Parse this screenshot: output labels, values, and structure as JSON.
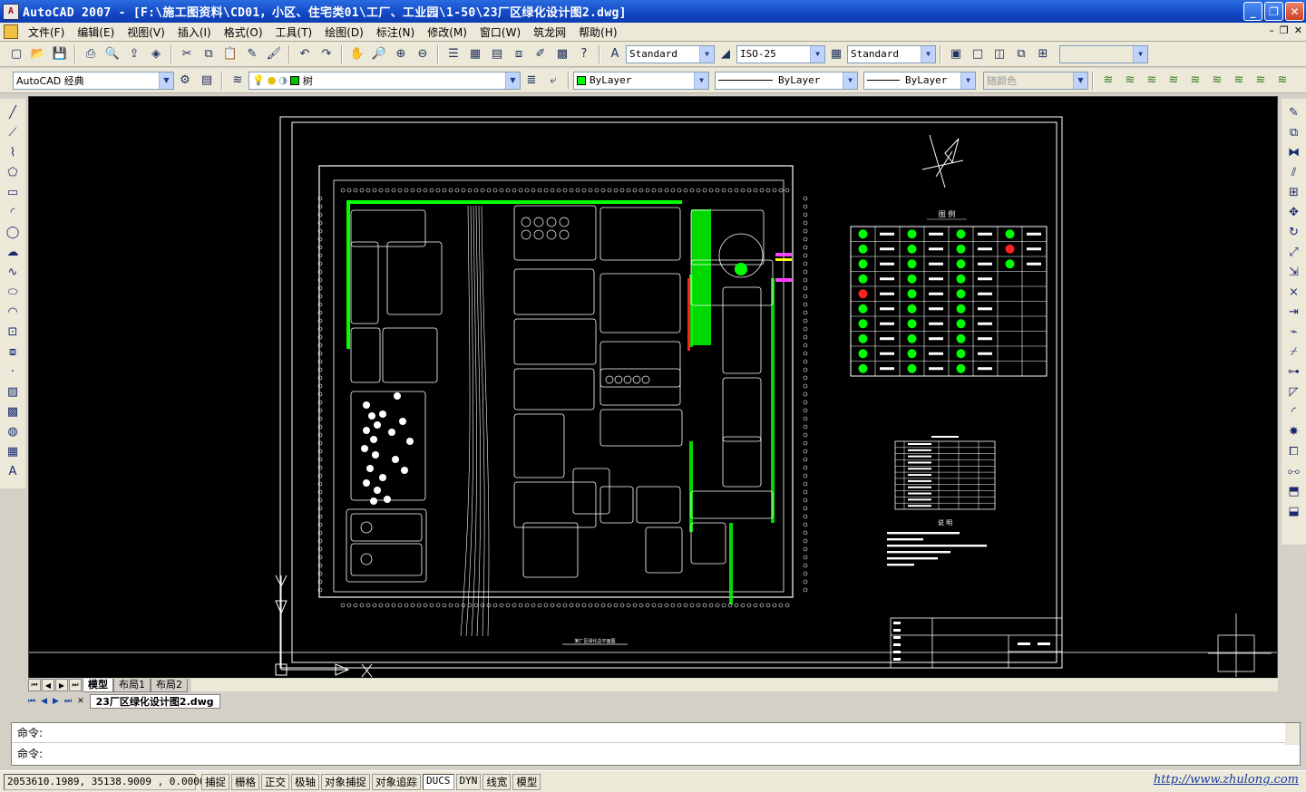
{
  "window": {
    "title": "AutoCAD 2007 - [F:\\施工图资料\\CD01，小区、住宅类01\\工厂、工业园\\1-50\\23厂区绿化设计图2.dwg]",
    "app_icon_text": "A",
    "minimize": "_",
    "maximize": "❐",
    "close": "✕"
  },
  "menubar": {
    "items": [
      "文件(F)",
      "编辑(E)",
      "视图(V)",
      "插入(I)",
      "格式(O)",
      "工具(T)",
      "绘图(D)",
      "标注(N)",
      "修改(M)",
      "窗口(W)",
      "筑龙网",
      "帮助(H)"
    ],
    "mdi_controls": [
      "–",
      "❐",
      "✕"
    ]
  },
  "toolbar_styles": {
    "text_style": "Standard",
    "dim_style": "ISO-25",
    "table_style": "Standard"
  },
  "toolbar_layers": {
    "workspace": "AutoCAD 经典",
    "layer": "树",
    "color": "ByLayer",
    "linetype": "ByLayer",
    "lineweight": "ByLayer",
    "plotstyle": "随颜色"
  },
  "icons": {
    "standard": [
      "new-icon",
      "open-icon",
      "save-icon",
      "plot-icon",
      "preview-icon",
      "publish-icon",
      "3dprint-icon",
      "cut-icon",
      "copy-icon",
      "paste-icon",
      "matchprop-icon",
      "brush-icon",
      "undo-icon",
      "redo-icon",
      "pan-icon",
      "zoom-realtime-icon",
      "zoom-window-icon",
      "zoom-previous-icon",
      "properties-icon",
      "designcenter-icon",
      "toolpalette-icon",
      "sheetset-icon",
      "markup-icon",
      "calculator-icon",
      "help-icon"
    ],
    "left": [
      "line-icon",
      "xline-icon",
      "pline-icon",
      "polygon-icon",
      "rectangle-icon",
      "arc-icon",
      "circle-icon",
      "revcloud-icon",
      "spline-icon",
      "ellipse-icon",
      "ellipse-arc-icon",
      "insert-block-icon",
      "make-block-icon",
      "point-icon",
      "hatch-icon",
      "gradient-icon",
      "region-icon",
      "table-icon",
      "mtext-icon"
    ],
    "right": [
      "erase-icon",
      "copy-object-icon",
      "mirror-icon",
      "offset-icon",
      "array-icon",
      "move-icon",
      "rotate-icon",
      "scale-icon",
      "stretch-icon",
      "trim-icon",
      "extend-icon",
      "break-point-icon",
      "break-icon",
      "join-icon",
      "chamfer-icon",
      "fillet-icon",
      "explode-icon",
      "draworder-front-icon",
      "draworder-back-icon",
      "draworder-above-icon",
      "draworder-under-icon"
    ]
  },
  "drawing": {
    "legend_title": "图 例",
    "caption_bottom": "某厂区绿化总平面图",
    "notes_title": "说 明",
    "colors": {
      "background": "#000000",
      "lines": "#ffffff",
      "trees": "#00ff00",
      "accent_red": "#ff2020",
      "accent_magenta": "#ff40ff",
      "accent_yellow": "#ffff00"
    }
  },
  "layout_tabs": {
    "tabs": [
      "模型",
      "布局1",
      "布局2"
    ],
    "active": "模型"
  },
  "document_tab": "23厂区绿化设计图2.dwg",
  "command": {
    "prompt1": "命令:",
    "prompt2": "命令:"
  },
  "statusbar": {
    "coords": "2053610.1989, 35138.9009 , 0.0000",
    "buttons": [
      "捕捉",
      "栅格",
      "正交",
      "极轴",
      "对象捕捉",
      "对象追踪",
      "DUCS",
      "DYN",
      "线宽",
      "模型"
    ],
    "link": "http://www.zhulong.com"
  }
}
